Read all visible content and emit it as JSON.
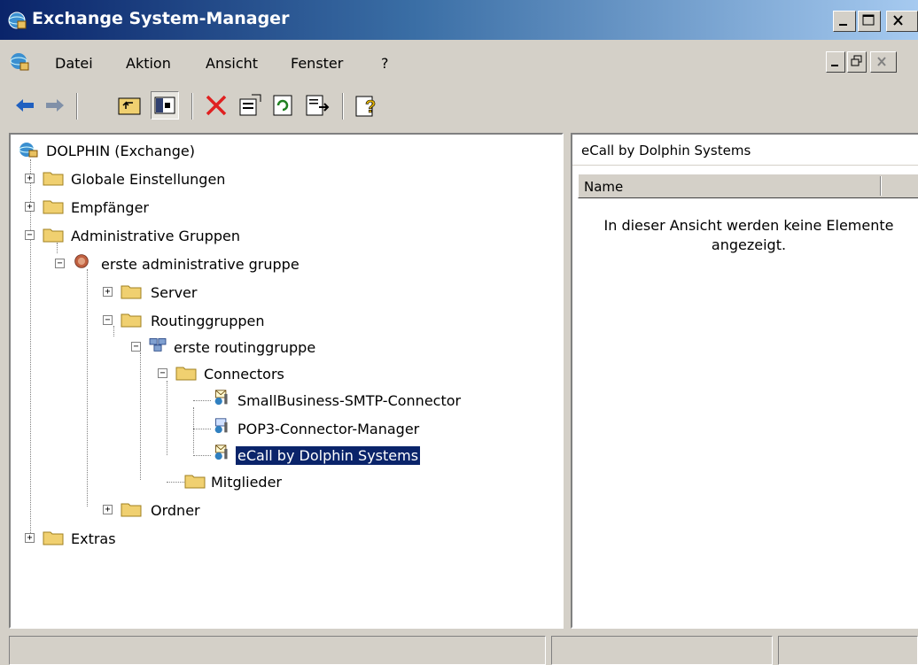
{
  "window": {
    "title": "Exchange System-Manager"
  },
  "menu": {
    "items": [
      "Datei",
      "Aktion",
      "Ansicht",
      "Fenster",
      "?"
    ]
  },
  "toolbar": {
    "buttons": [
      "back",
      "forward",
      "up-one-level",
      "show-hide-console-tree",
      "delete",
      "properties",
      "refresh",
      "export-list",
      "help"
    ]
  },
  "tree": {
    "root": "DOLPHIN (Exchange)",
    "global_settings": "Globale Einstellungen",
    "recipients": "Empfänger",
    "admin_groups": "Administrative Gruppen",
    "admin_group_1": "erste administrative gruppe",
    "server": "Server",
    "routing_groups": "Routinggruppen",
    "routing_group_1": "erste routinggruppe",
    "connectors": "Connectors",
    "connector_smtp": "SmallBusiness-SMTP-Connector",
    "connector_pop3": "POP3-Connector-Manager",
    "connector_ecall": "eCall by Dolphin Systems",
    "members": "Mitglieder",
    "folders": "Ordner",
    "extras": "Extras"
  },
  "details": {
    "title": "eCall by Dolphin Systems",
    "column_name": "Name",
    "empty_line1": "In dieser Ansicht werden keine Elemente",
    "empty_line2": "angezeigt."
  },
  "colors": {
    "selection": "#0a246a",
    "titlebar_start": "#0a246a",
    "titlebar_end": "#a6caf0",
    "chrome": "#d4d0c8"
  }
}
